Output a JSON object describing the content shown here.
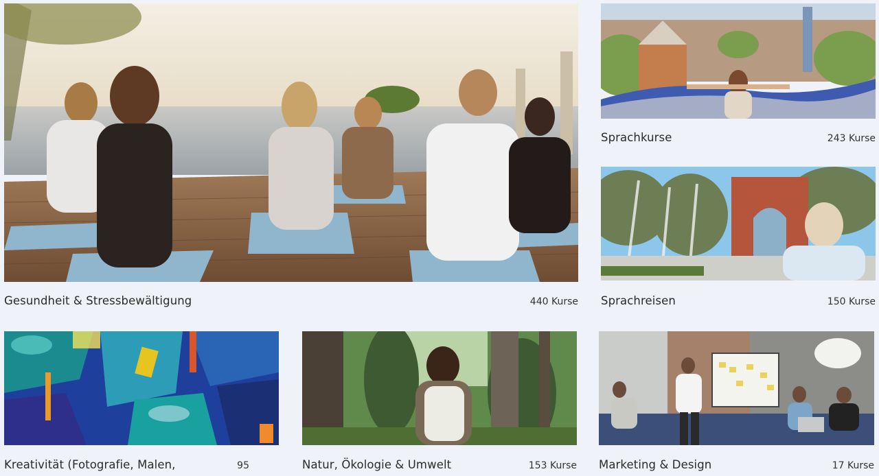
{
  "categories": [
    {
      "title": "Gesundheit & Stressbewältigung",
      "count": "440 Kurse",
      "image": "yoga-group-on-beach-deck-photo"
    },
    {
      "title": "Sprachkurse",
      "count": "243 Kurse",
      "image": "park-guell-barcelona-photo"
    },
    {
      "title": "Sprachreisen",
      "count": "150 Kurse",
      "image": "arc-de-triomf-barcelona-photo"
    },
    {
      "title": "Kreativität (Fotografie, Malen,",
      "count": "95",
      "image": "abstract-acrylic-painting-photo"
    },
    {
      "title": "Natur, Ökologie & Umwelt",
      "count": "153 Kurse",
      "image": "hiker-in-forest-photo"
    },
    {
      "title": "Marketing & Design",
      "count": "17 Kurse",
      "image": "office-whiteboard-meeting-photo"
    }
  ]
}
